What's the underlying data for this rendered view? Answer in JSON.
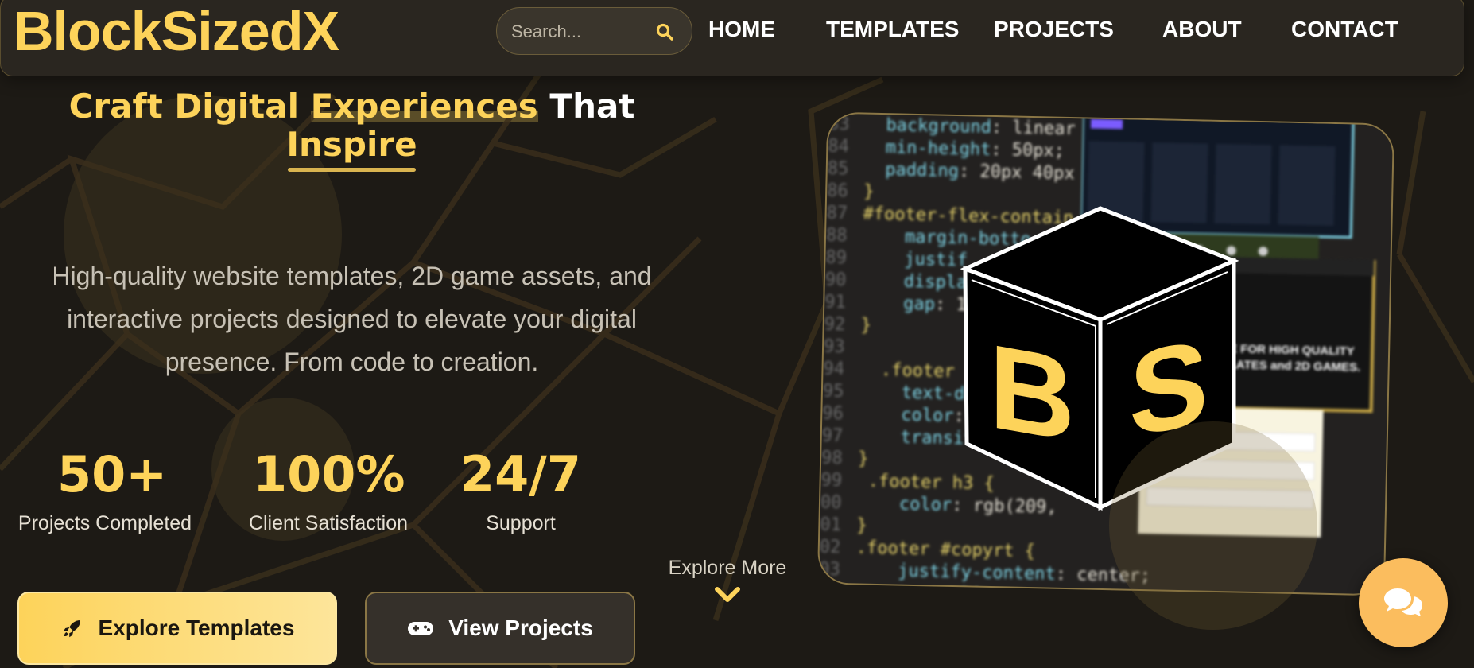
{
  "brand": {
    "name": "BlockSizedX",
    "accent": "#fdd35a",
    "background": "#1d1a15"
  },
  "search": {
    "placeholder": "Search...",
    "icon": "search-icon"
  },
  "nav": {
    "items": [
      {
        "label": "HOME"
      },
      {
        "label": "TEMPLATES"
      },
      {
        "label": "PROJECTS"
      },
      {
        "label": "ABOUT"
      },
      {
        "label": "CONTACT"
      }
    ]
  },
  "hero": {
    "title": {
      "part1": "Craft Digital ",
      "part2": "Experiences",
      "part3": " That",
      "part4": "Inspire"
    },
    "description": "High-quality website templates, 2D game assets, and interactive projects designed to elevate your digital presence. From code to creation.",
    "stats": [
      {
        "value": "50+",
        "label": "Projects Completed"
      },
      {
        "value": "100%",
        "label": "Client Satisfaction"
      },
      {
        "value": "24/7",
        "label": "Support"
      }
    ],
    "buttons": {
      "primary": {
        "label": "Explore Templates",
        "icon": "rocket-icon"
      },
      "secondary": {
        "label": "View Projects",
        "icon": "gamepad-icon"
      }
    },
    "explore_more": "Explore More",
    "logo_letters": "BS"
  },
  "chat": {
    "icon": "chat-bubbles-icon",
    "color": "#fbbd5e"
  }
}
